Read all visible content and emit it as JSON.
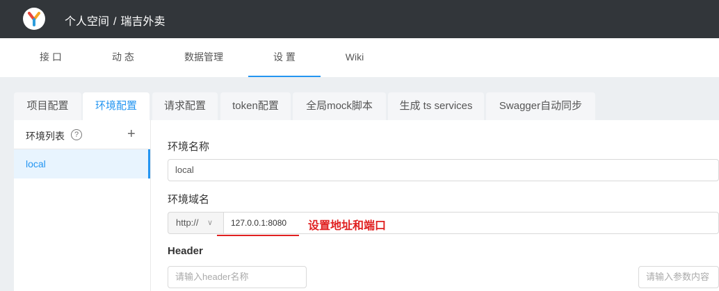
{
  "header": {
    "logo_icon": "yapi-logo-icon",
    "breadcrumb": [
      "个人空间",
      "/",
      "瑞吉外卖"
    ]
  },
  "nav_tabs": [
    {
      "label": "接 口",
      "active": false
    },
    {
      "label": "动 态",
      "active": false
    },
    {
      "label": "数据管理",
      "active": false
    },
    {
      "label": "设 置",
      "active": true
    },
    {
      "label": "Wiki",
      "active": false
    }
  ],
  "settings_tabs": [
    {
      "label": "项目配置",
      "active": false
    },
    {
      "label": "环境配置",
      "active": true
    },
    {
      "label": "请求配置",
      "active": false
    },
    {
      "label": "token配置",
      "active": false
    },
    {
      "label": "全局mock脚本",
      "active": false
    },
    {
      "label": "生成 ts services",
      "active": false
    },
    {
      "label": "Swagger自动同步",
      "active": false
    }
  ],
  "env_list": {
    "title": "环境列表",
    "help_icon": "question-circle-icon",
    "add_icon": "plus-icon",
    "items": [
      {
        "label": "local",
        "selected": true
      }
    ]
  },
  "env_form": {
    "name_label": "环境名称",
    "name_value": "local",
    "domain_label": "环境域名",
    "protocol": "http://",
    "domain_value": "127.0.0.1:8080",
    "header_label": "Header",
    "header_name_placeholder": "请输入header名称",
    "header_value_placeholder": "请输入参数内容"
  },
  "annotation": {
    "text": "设置地址和端口",
    "color": "#e02020"
  },
  "colors": {
    "topbar": "#32363a",
    "accent": "#2395f1",
    "page_bg": "#eceff2"
  }
}
